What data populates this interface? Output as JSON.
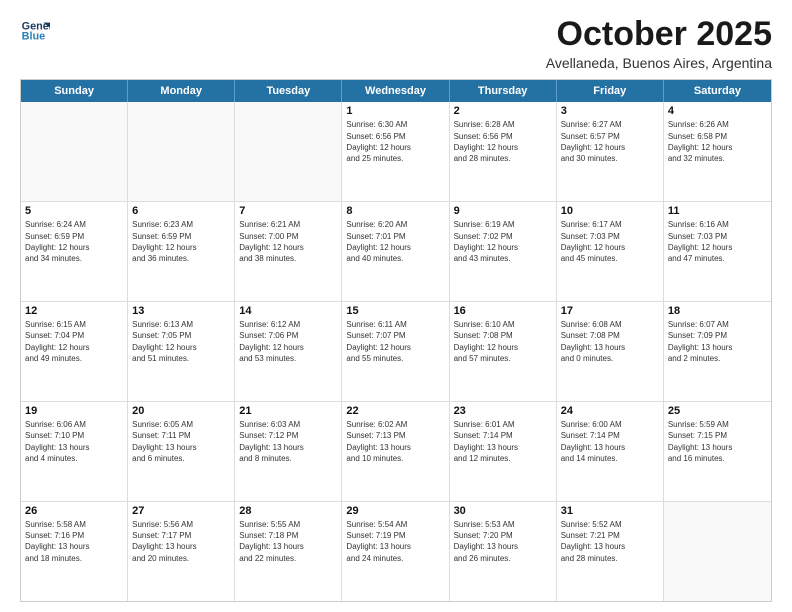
{
  "header": {
    "logo_line1": "General",
    "logo_line2": "Blue",
    "month": "October 2025",
    "location": "Avellaneda, Buenos Aires, Argentina"
  },
  "weekdays": [
    "Sunday",
    "Monday",
    "Tuesday",
    "Wednesday",
    "Thursday",
    "Friday",
    "Saturday"
  ],
  "rows": [
    [
      {
        "day": "",
        "info": ""
      },
      {
        "day": "",
        "info": ""
      },
      {
        "day": "",
        "info": ""
      },
      {
        "day": "1",
        "info": "Sunrise: 6:30 AM\nSunset: 6:56 PM\nDaylight: 12 hours\nand 25 minutes."
      },
      {
        "day": "2",
        "info": "Sunrise: 6:28 AM\nSunset: 6:56 PM\nDaylight: 12 hours\nand 28 minutes."
      },
      {
        "day": "3",
        "info": "Sunrise: 6:27 AM\nSunset: 6:57 PM\nDaylight: 12 hours\nand 30 minutes."
      },
      {
        "day": "4",
        "info": "Sunrise: 6:26 AM\nSunset: 6:58 PM\nDaylight: 12 hours\nand 32 minutes."
      }
    ],
    [
      {
        "day": "5",
        "info": "Sunrise: 6:24 AM\nSunset: 6:59 PM\nDaylight: 12 hours\nand 34 minutes."
      },
      {
        "day": "6",
        "info": "Sunrise: 6:23 AM\nSunset: 6:59 PM\nDaylight: 12 hours\nand 36 minutes."
      },
      {
        "day": "7",
        "info": "Sunrise: 6:21 AM\nSunset: 7:00 PM\nDaylight: 12 hours\nand 38 minutes."
      },
      {
        "day": "8",
        "info": "Sunrise: 6:20 AM\nSunset: 7:01 PM\nDaylight: 12 hours\nand 40 minutes."
      },
      {
        "day": "9",
        "info": "Sunrise: 6:19 AM\nSunset: 7:02 PM\nDaylight: 12 hours\nand 43 minutes."
      },
      {
        "day": "10",
        "info": "Sunrise: 6:17 AM\nSunset: 7:03 PM\nDaylight: 12 hours\nand 45 minutes."
      },
      {
        "day": "11",
        "info": "Sunrise: 6:16 AM\nSunset: 7:03 PM\nDaylight: 12 hours\nand 47 minutes."
      }
    ],
    [
      {
        "day": "12",
        "info": "Sunrise: 6:15 AM\nSunset: 7:04 PM\nDaylight: 12 hours\nand 49 minutes."
      },
      {
        "day": "13",
        "info": "Sunrise: 6:13 AM\nSunset: 7:05 PM\nDaylight: 12 hours\nand 51 minutes."
      },
      {
        "day": "14",
        "info": "Sunrise: 6:12 AM\nSunset: 7:06 PM\nDaylight: 12 hours\nand 53 minutes."
      },
      {
        "day": "15",
        "info": "Sunrise: 6:11 AM\nSunset: 7:07 PM\nDaylight: 12 hours\nand 55 minutes."
      },
      {
        "day": "16",
        "info": "Sunrise: 6:10 AM\nSunset: 7:08 PM\nDaylight: 12 hours\nand 57 minutes."
      },
      {
        "day": "17",
        "info": "Sunrise: 6:08 AM\nSunset: 7:08 PM\nDaylight: 13 hours\nand 0 minutes."
      },
      {
        "day": "18",
        "info": "Sunrise: 6:07 AM\nSunset: 7:09 PM\nDaylight: 13 hours\nand 2 minutes."
      }
    ],
    [
      {
        "day": "19",
        "info": "Sunrise: 6:06 AM\nSunset: 7:10 PM\nDaylight: 13 hours\nand 4 minutes."
      },
      {
        "day": "20",
        "info": "Sunrise: 6:05 AM\nSunset: 7:11 PM\nDaylight: 13 hours\nand 6 minutes."
      },
      {
        "day": "21",
        "info": "Sunrise: 6:03 AM\nSunset: 7:12 PM\nDaylight: 13 hours\nand 8 minutes."
      },
      {
        "day": "22",
        "info": "Sunrise: 6:02 AM\nSunset: 7:13 PM\nDaylight: 13 hours\nand 10 minutes."
      },
      {
        "day": "23",
        "info": "Sunrise: 6:01 AM\nSunset: 7:14 PM\nDaylight: 13 hours\nand 12 minutes."
      },
      {
        "day": "24",
        "info": "Sunrise: 6:00 AM\nSunset: 7:14 PM\nDaylight: 13 hours\nand 14 minutes."
      },
      {
        "day": "25",
        "info": "Sunrise: 5:59 AM\nSunset: 7:15 PM\nDaylight: 13 hours\nand 16 minutes."
      }
    ],
    [
      {
        "day": "26",
        "info": "Sunrise: 5:58 AM\nSunset: 7:16 PM\nDaylight: 13 hours\nand 18 minutes."
      },
      {
        "day": "27",
        "info": "Sunrise: 5:56 AM\nSunset: 7:17 PM\nDaylight: 13 hours\nand 20 minutes."
      },
      {
        "day": "28",
        "info": "Sunrise: 5:55 AM\nSunset: 7:18 PM\nDaylight: 13 hours\nand 22 minutes."
      },
      {
        "day": "29",
        "info": "Sunrise: 5:54 AM\nSunset: 7:19 PM\nDaylight: 13 hours\nand 24 minutes."
      },
      {
        "day": "30",
        "info": "Sunrise: 5:53 AM\nSunset: 7:20 PM\nDaylight: 13 hours\nand 26 minutes."
      },
      {
        "day": "31",
        "info": "Sunrise: 5:52 AM\nSunset: 7:21 PM\nDaylight: 13 hours\nand 28 minutes."
      },
      {
        "day": "",
        "info": ""
      }
    ]
  ]
}
